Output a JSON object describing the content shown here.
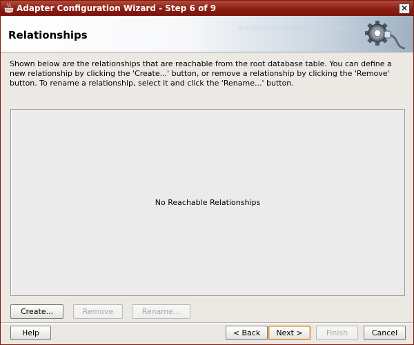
{
  "window": {
    "title": "Adapter Configuration Wizard - Step 6 of 9",
    "close_glyph": "✕"
  },
  "header": {
    "title": "Relationships",
    "decoration_text": "0101010101010101010101010 1010101010101010101010"
  },
  "description": "Shown below are the relationships that are reachable from the root database table.  You can define a new relationship by clicking the 'Create...' button, or remove a relationship by clicking the 'Remove' button.  To rename a relationship, select it and click the 'Rename...' button.",
  "relationships": {
    "items": [],
    "empty_message": "No Reachable Relationships"
  },
  "actions": {
    "create": {
      "label": "Create...",
      "enabled": true
    },
    "remove": {
      "label": "Remove",
      "enabled": false
    },
    "rename": {
      "label": "Rename...",
      "enabled": false
    }
  },
  "navigation": {
    "help": {
      "label": "Help",
      "enabled": true
    },
    "back": {
      "label": "< Back",
      "enabled": true
    },
    "next": {
      "label": "Next >",
      "enabled": true,
      "default": true
    },
    "finish": {
      "label": "Finish",
      "enabled": false
    },
    "cancel": {
      "label": "Cancel",
      "enabled": true
    }
  },
  "icons": {
    "title_icon": "coffee-cup-icon",
    "header_graphic": "gear-plug-icon"
  }
}
